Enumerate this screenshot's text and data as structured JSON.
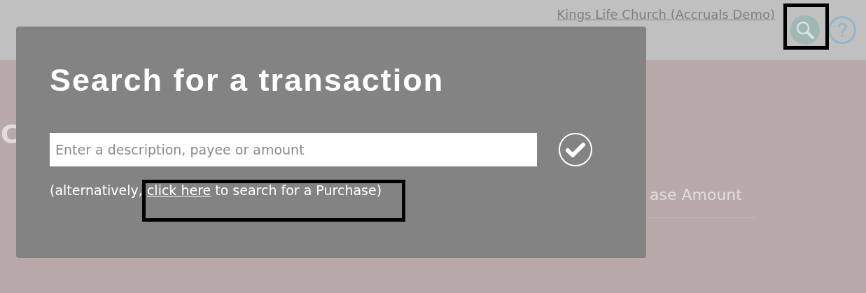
{
  "header": {
    "account_link": "Kings Life Church (Accruals Demo)"
  },
  "page": {
    "heading_fragment": "C",
    "column_fragment": "ase Amount"
  },
  "dialog": {
    "title": "Search for a transaction",
    "search_field": {
      "placeholder": "Enter a description, payee or amount"
    },
    "note": {
      "before": "(alternatively, ",
      "link": "click here",
      "after": " to search for a Purchase)"
    }
  }
}
